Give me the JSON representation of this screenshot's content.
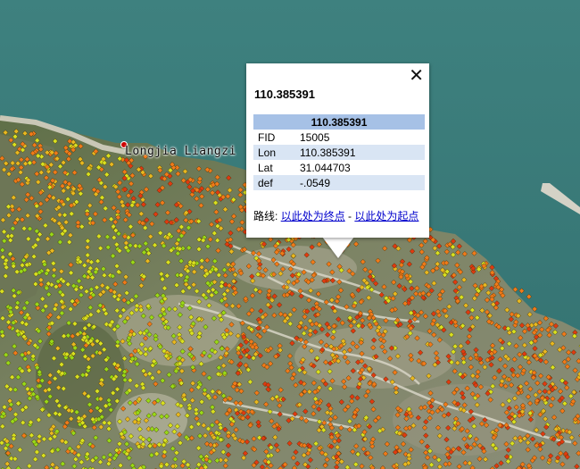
{
  "map": {
    "place_label": "Longjia Liangzi",
    "point_colors": {
      "red": "#e03a10",
      "orange": "#f07a1a",
      "yellow_orange": "#e8b820",
      "yellow": "#d8e020",
      "green": "#98d818"
    },
    "water_color": "#3a7a78"
  },
  "popup": {
    "close_symbol": "✕",
    "title": "110.385391",
    "table_header": "110.385391",
    "rows": [
      {
        "key": "FID",
        "value": "15005"
      },
      {
        "key": "Lon",
        "value": "110.385391"
      },
      {
        "key": "Lat",
        "value": "31.044703"
      },
      {
        "key": "def",
        "value": "-.0549"
      }
    ],
    "route_label": "路线:",
    "route_to": "以此处为终点",
    "route_sep": " - ",
    "route_from": "以此处为起点"
  }
}
